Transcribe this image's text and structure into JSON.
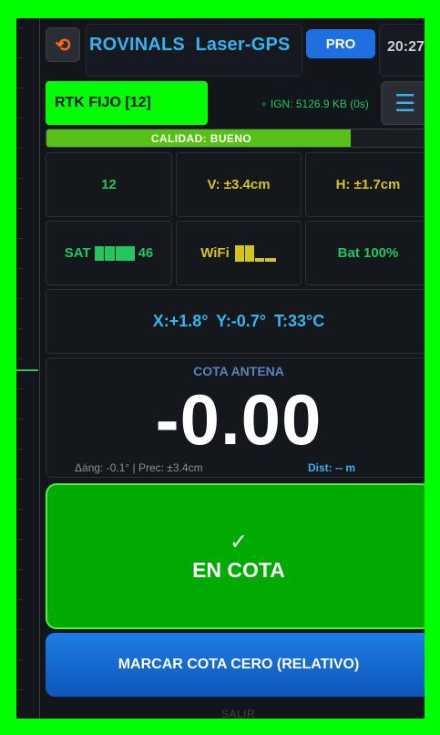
{
  "header": {
    "back_icon": "reset-icon",
    "brand": "ROVINALS",
    "app": "Laser-GPS",
    "pro_label": "PRO",
    "time": "20:27"
  },
  "status": {
    "rtk": "RTK FIJO [12]",
    "ign": "IGN: 5126.9 KB (0s)",
    "menu_icon": "menu-icon"
  },
  "quality": {
    "label": "CALIDAD: BUENO",
    "level_fraction": 0.8
  },
  "grid": {
    "satellites": "12",
    "vertical": "V: ±3.4cm",
    "horizontal": "H: ±1.7cm",
    "sat_label": "SAT",
    "sat_value": "46",
    "wifi_label": "WiFi",
    "battery": "Bat 100%"
  },
  "tilt": {
    "text": "X:+1.8°  Y:-0.7°  T:33°C"
  },
  "cota": {
    "label": "COTA ANTENA",
    "value": "-0.00",
    "meta": "Δáng: -0.1° | Prec: ±3.4cm",
    "dist": "Dist: -- m"
  },
  "on_cota": {
    "check": "✓",
    "label": "EN COTA"
  },
  "actions": {
    "zero": "MARCAR COTA CERO (RELATIVO)",
    "exit": "SALIR"
  },
  "colors": {
    "border": "#00ff00",
    "accent": "#33b6f0",
    "ok": "#22c55e",
    "warn": "#d4c51a",
    "primary": "#1f6fe0"
  }
}
